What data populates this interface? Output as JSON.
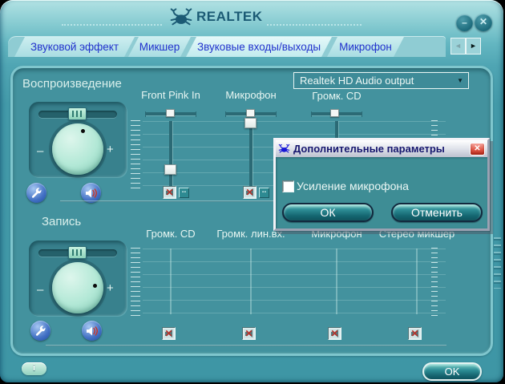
{
  "header": {
    "brand": "REALTEK"
  },
  "icons": {
    "minimize": "–",
    "close": "✕",
    "scroll_left": "◄",
    "scroll_right": "►",
    "dropdown_arrow": "▼",
    "mute_cross": "✕",
    "dots_more": "..",
    "knob_minus": "–",
    "knob_plus": "+",
    "info": "i",
    "dialog_close": "✕"
  },
  "tabs": {
    "items": [
      {
        "label": "Звуковой эффект",
        "active": false
      },
      {
        "label": "Микшер",
        "active": false
      },
      {
        "label": "Звуковые входы/выходы",
        "active": true
      },
      {
        "label": "Микрофон",
        "active": false
      }
    ]
  },
  "playback": {
    "title": "Воспроизведение",
    "device_selector": "Realtek HD Audio output",
    "channels": [
      {
        "label": "Front Pink In",
        "balance_pct": 50,
        "volume_pct": 12,
        "muted": true
      },
      {
        "label": "Микрофон",
        "balance_pct": 50,
        "volume_pct": 92,
        "muted": true
      },
      {
        "label": "Громк. CD",
        "balance_pct": 48
      }
    ]
  },
  "recording": {
    "title": "Запись",
    "channels": [
      {
        "label": "Громк. CD",
        "muted": true
      },
      {
        "label": "Громк. лин.вх.",
        "muted": true
      },
      {
        "label": "Микрофон",
        "muted": true
      },
      {
        "label": "Стерео микшер",
        "muted": true
      }
    ]
  },
  "dialog": {
    "title": "Дополнительные параметры",
    "checkbox_label": "Усиление микрофона",
    "checkbox_checked": false,
    "ok_label": "ОК",
    "cancel_label": "Отменить"
  },
  "footer": {
    "ok_label": "OK"
  },
  "colors": {
    "frame_teal": "#4fa5b3",
    "panel_teal": "#43929e",
    "tab_text_blue": "#2232cd",
    "knob_mint": "#b2e8d6",
    "dialog_body": "#3e8d95",
    "close_red": "#e05848"
  }
}
